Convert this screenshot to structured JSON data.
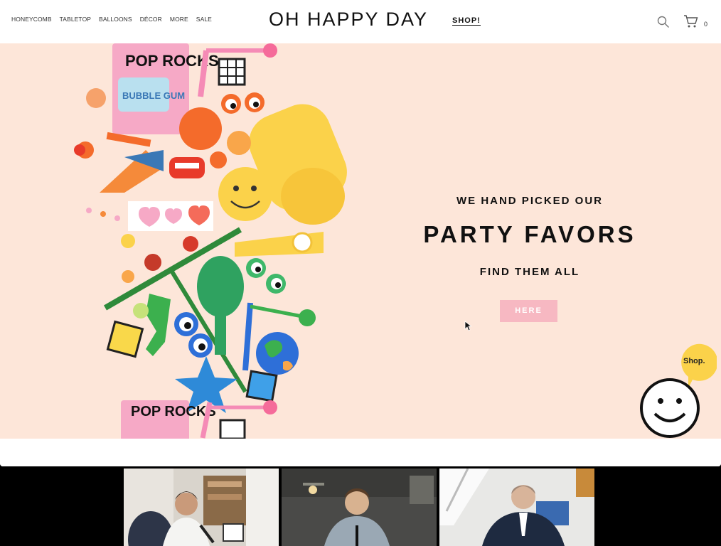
{
  "nav": {
    "items": [
      "HONEYCOMB",
      "TABLETOP",
      "BALLOONS",
      "DÉCOR",
      "MORE",
      "SALE"
    ]
  },
  "header": {
    "logo": "OH HAPPY DAY",
    "shop_link": "SHOP!",
    "cart_count": "0"
  },
  "hero": {
    "subtitle": "WE HAND PICKED OUR",
    "title": "PARTY FAVORS",
    "tagline": "FIND THEM ALL",
    "button_label": "HERE",
    "candy_brand": "POP ROCKS",
    "candy_flavor": "BUBBLE GUM"
  },
  "mascot": {
    "bubble_label": "Shop."
  },
  "colors": {
    "hero_bg": "#fde6d9",
    "button_bg": "#f7b8c2",
    "bubble": "#fbd24a"
  },
  "icons": [
    "search-icon",
    "cart-icon",
    "smiley-icon",
    "cursor-icon"
  ]
}
